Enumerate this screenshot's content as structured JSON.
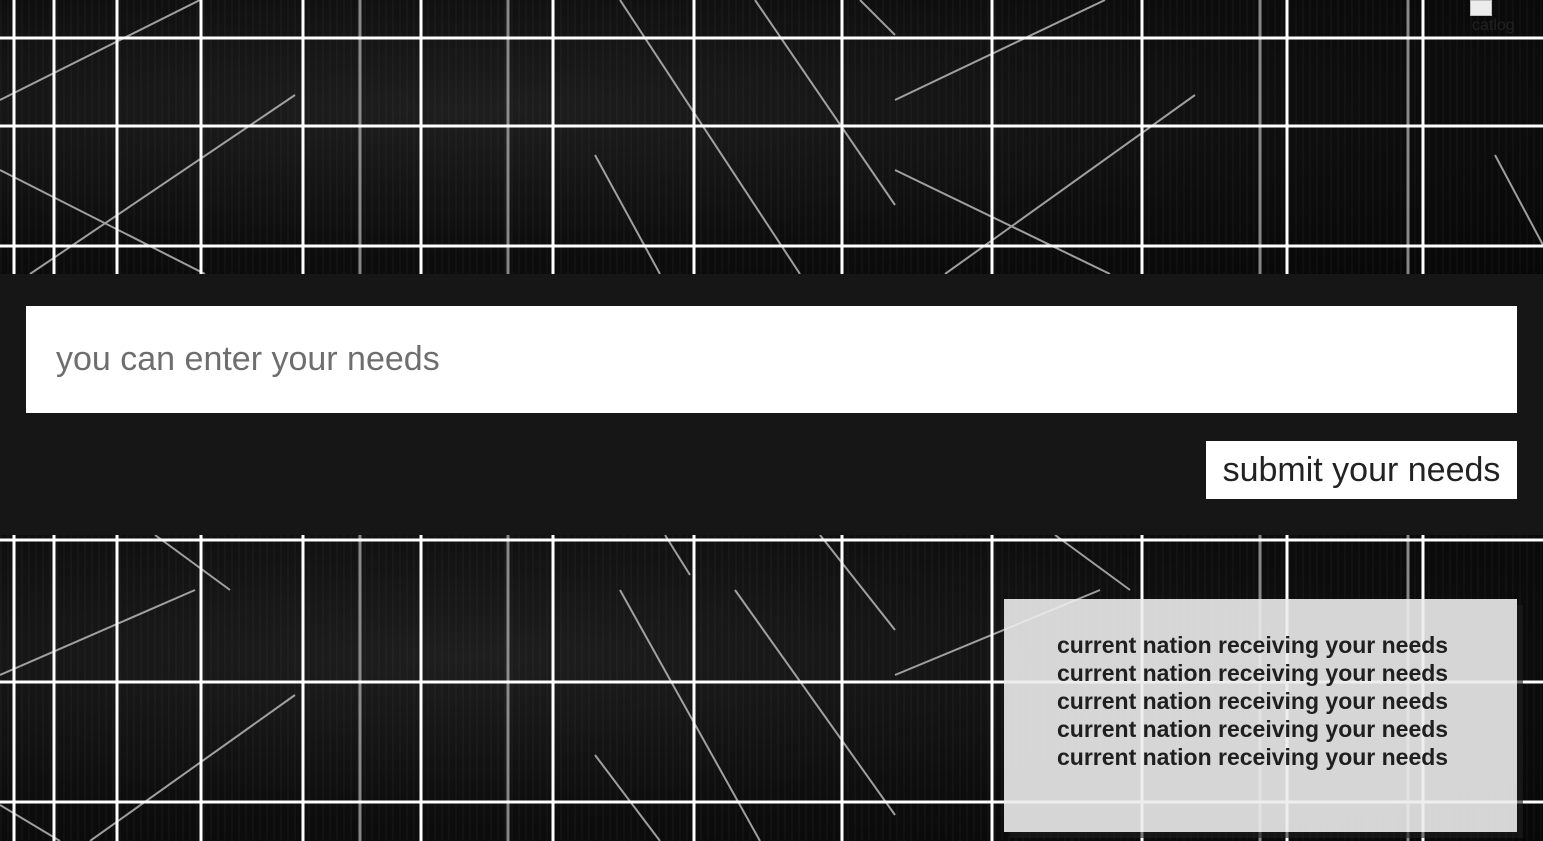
{
  "header_image": {
    "alt_text": "catlog"
  },
  "needs_form": {
    "input_value": "",
    "input_placeholder": "you can enter your needs",
    "submit_label": "submit your needs"
  },
  "status_panel": {
    "lines": [
      "current nation receiving your needs",
      "current nation receiving your needs",
      "current nation receiving your needs",
      "current nation receiving your needs",
      "current nation receiving your needs"
    ]
  },
  "colors": {
    "page_background": "#161616",
    "grid_line": "#ffffff",
    "input_background": "#ffffff",
    "panel_background": "#ececec"
  }
}
